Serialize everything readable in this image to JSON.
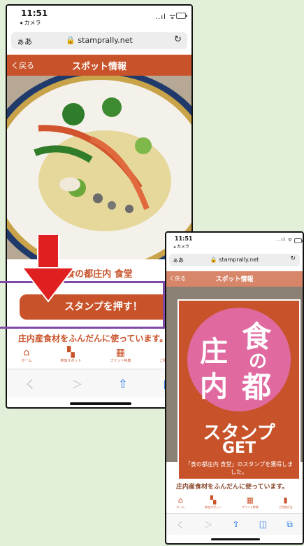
{
  "status": {
    "time": "11:51",
    "back_app": "◂ カメラ",
    "signal": "..ıl ᯤ"
  },
  "browser": {
    "aa": "ぁあ",
    "url": "stamprally.net",
    "reload": "↻"
  },
  "nav": {
    "back": "く戻る",
    "title": "スポット情報"
  },
  "spot": {
    "name": "食の都庄内 食堂",
    "stamp_button": "スタンプを押す！",
    "description": "庄内産食材をふんだんに使っています。"
  },
  "tabs": [
    {
      "label": "ホーム",
      "icon": "home-icon"
    },
    {
      "label": "参加スポット",
      "icon": "map-icon"
    },
    {
      "label": "プリント特典",
      "icon": "gift-icon"
    },
    {
      "label": "ご利用方法",
      "icon": "book-icon"
    }
  ],
  "safari": {
    "back": "く",
    "forward": "＞",
    "share": "⇧",
    "bookmarks": "◫",
    "tabs": "⧉"
  },
  "popup": {
    "logo_chars": [
      "食",
      "庄",
      "の",
      "内",
      "都"
    ],
    "title_line1": "スタンプ",
    "title_line2": "GET",
    "message": "「食の都庄内 食堂」のスタンプを獲得しました。"
  },
  "colors": {
    "accent": "#c8532a",
    "pink": "#e06aa0",
    "arrow": "#e02020",
    "callout": "#7e4aa6",
    "background": "#e2f0d9"
  }
}
